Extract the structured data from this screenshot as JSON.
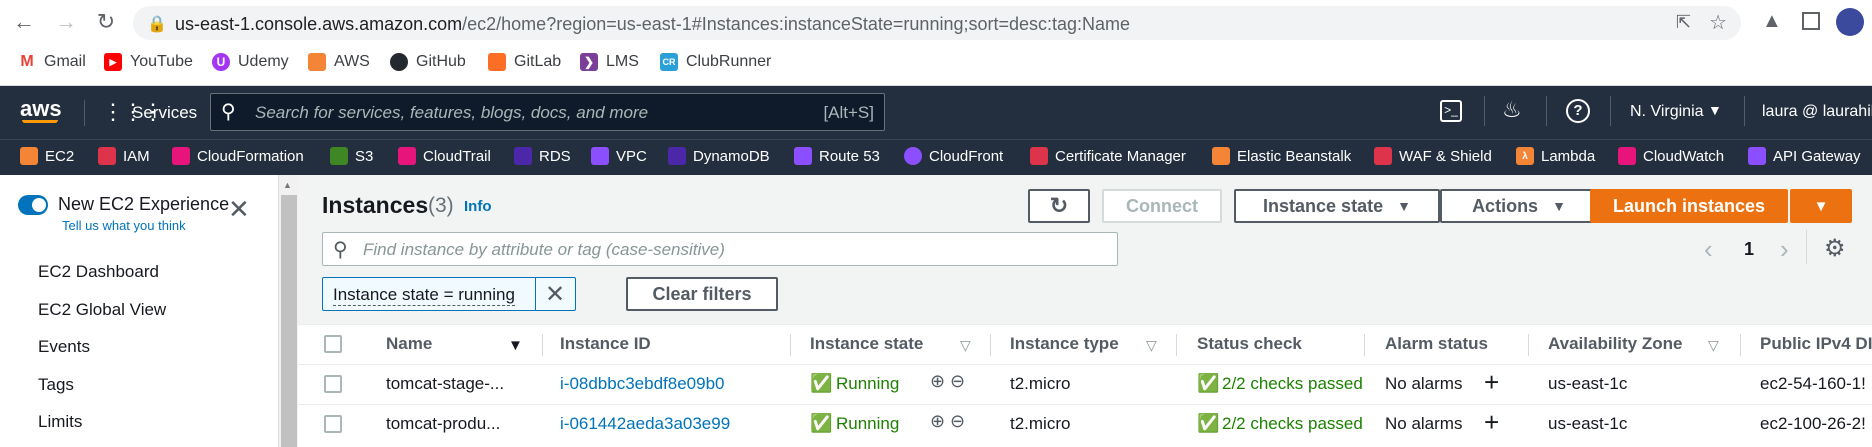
{
  "browser": {
    "url_host": "us-east-1.console.aws.amazon.com",
    "url_path": "/ec2/home?region=us-east-1#Instances:instanceState=running;sort=desc:tag:Name",
    "bookmarks": [
      "Gmail",
      "YouTube",
      "Udemy",
      "AWS",
      "GitHub",
      "GitLab",
      "LMS",
      "ClubRunner"
    ]
  },
  "aws_header": {
    "logo": "aws",
    "services_label": "Services",
    "search_placeholder": "Search for services, features, blogs, docs, and more",
    "search_shortcut": "[Alt+S]",
    "region": "N. Virginia",
    "user": "laura @ laurahil"
  },
  "service_shortcuts": [
    "EC2",
    "IAM",
    "CloudFormation",
    "S3",
    "CloudTrail",
    "RDS",
    "VPC",
    "DynamoDB",
    "Route 53",
    "CloudFront",
    "Certificate Manager",
    "Elastic Beanstalk",
    "WAF & Shield",
    "Lambda",
    "CloudWatch",
    "API Gateway"
  ],
  "sidebar": {
    "toggle_label": "New EC2 Experience",
    "toggle_sub": "Tell us what you think",
    "items": [
      "EC2 Dashboard",
      "EC2 Global View",
      "Events",
      "Tags",
      "Limits"
    ]
  },
  "instances": {
    "title": "Instances",
    "count": "(3)",
    "info": "Info",
    "connect": "Connect",
    "instance_state": "Instance state",
    "actions": "Actions",
    "launch": "Launch instances",
    "filter_placeholder": "Find instance by attribute or tag (case-sensitive)",
    "page": "1",
    "filter_token": "Instance state = running",
    "clear_filters": "Clear filters",
    "columns": [
      "Name",
      "Instance ID",
      "Instance state",
      "Instance type",
      "Status check",
      "Alarm status",
      "Availability Zone",
      "Public IPv4 DI"
    ],
    "rows": [
      {
        "name": "tomcat-stage-...",
        "id": "i-08dbbc3ebdf8e09b0",
        "state": "Running",
        "type": "t2.micro",
        "status": "2/2 checks passed",
        "alarm": "No alarms",
        "az": "us-east-1c",
        "dns": "ec2-54-160-1!"
      },
      {
        "name": "tomcat-produ...",
        "id": "i-061442aeda3a03e99",
        "state": "Running",
        "type": "t2.micro",
        "status": "2/2 checks passed",
        "alarm": "No alarms",
        "az": "us-east-1c",
        "dns": "ec2-100-26-2!"
      }
    ]
  },
  "colors": {
    "aws_nav": "#232f3e",
    "orange": "#ec7211",
    "link": "#0073bb",
    "green": "#1d8102"
  }
}
